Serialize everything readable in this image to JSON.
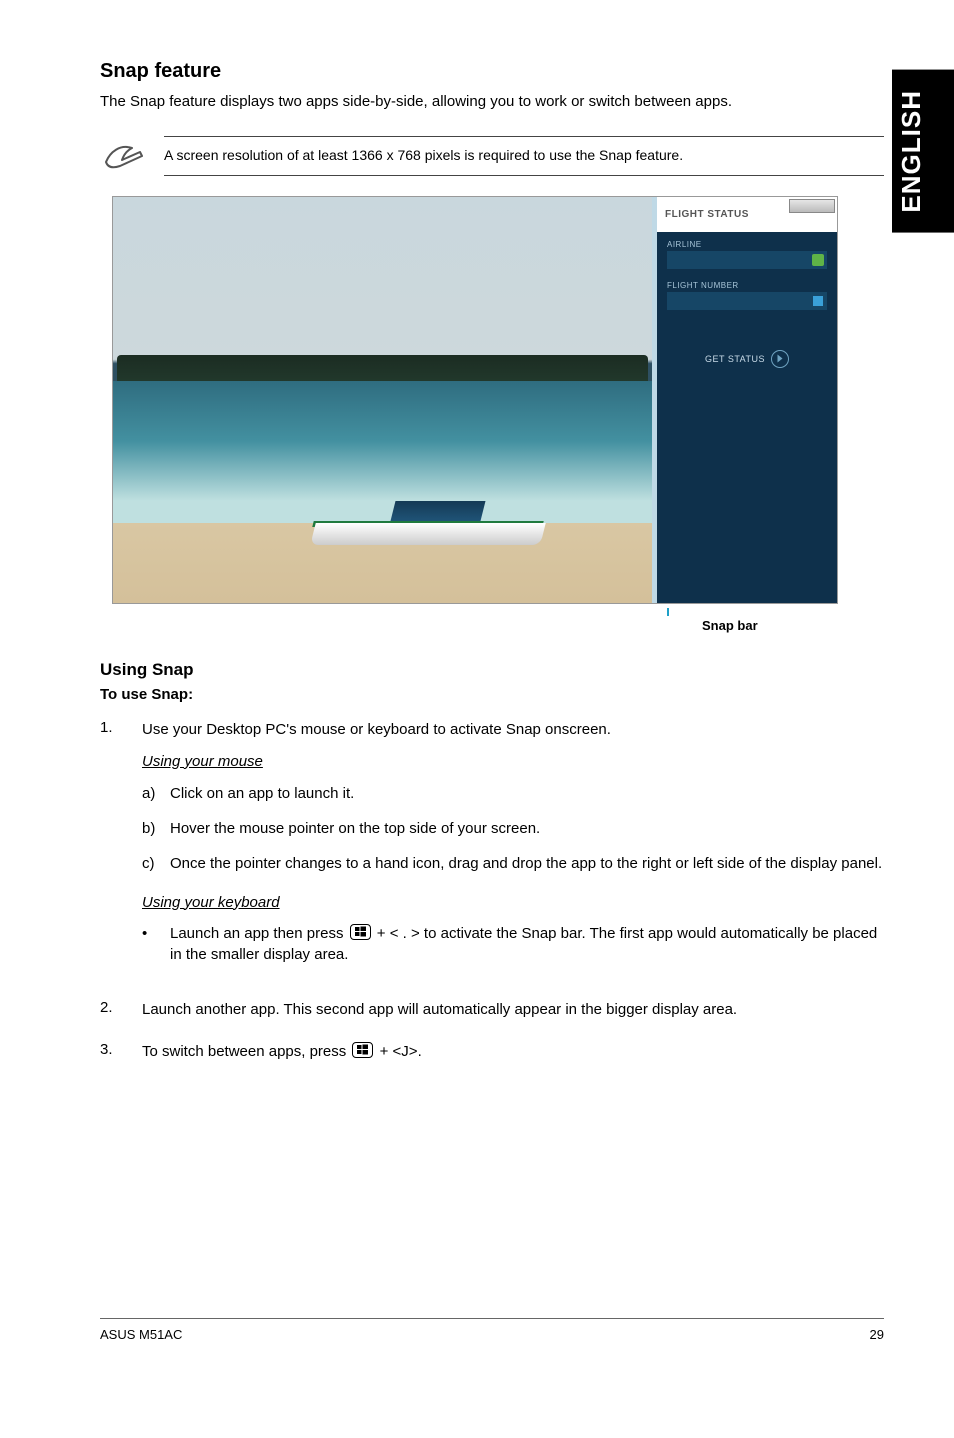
{
  "side_label": "ENGLISH",
  "section": {
    "title": "Snap feature",
    "lead": "The Snap feature displays two apps side-by-side, allowing you to work or switch between apps."
  },
  "note": {
    "text": "A screen resolution of at least 1366 x 768 pixels is required to use the Snap feature."
  },
  "screenshot": {
    "pane_title": "FLIGHT STATUS",
    "field1_label": "AIRLINE",
    "field2_label": "FLIGHT NUMBER",
    "status_label": "GET STATUS",
    "caption": "Snap bar"
  },
  "using": {
    "heading": "Using Snap",
    "to_use": "To use Snap:",
    "step1": "Use your Desktop PC's mouse or keyboard to activate Snap onscreen.",
    "mouse_heading": "Using your mouse",
    "mouse_a": "Click on an app to launch it.",
    "mouse_b": "Hover the mouse pointer on the top side of your screen.",
    "mouse_c": "Once the pointer changes to a hand icon, drag and drop the app to the right or left side of the display panel.",
    "keyboard_heading": "Using your keyboard",
    "keyboard_bullet_pre": "Launch an app then press ",
    "keyboard_bullet_mid": " + < . > to activate the Snap bar. The first app would automatically be placed in the smaller display area.",
    "step2": "Launch another app. This second app will automatically appear in the bigger display area.",
    "step3_pre": "To switch between apps, press ",
    "step3_post": " + <J>."
  },
  "footer": {
    "left": "ASUS M51AC",
    "right": "29"
  }
}
